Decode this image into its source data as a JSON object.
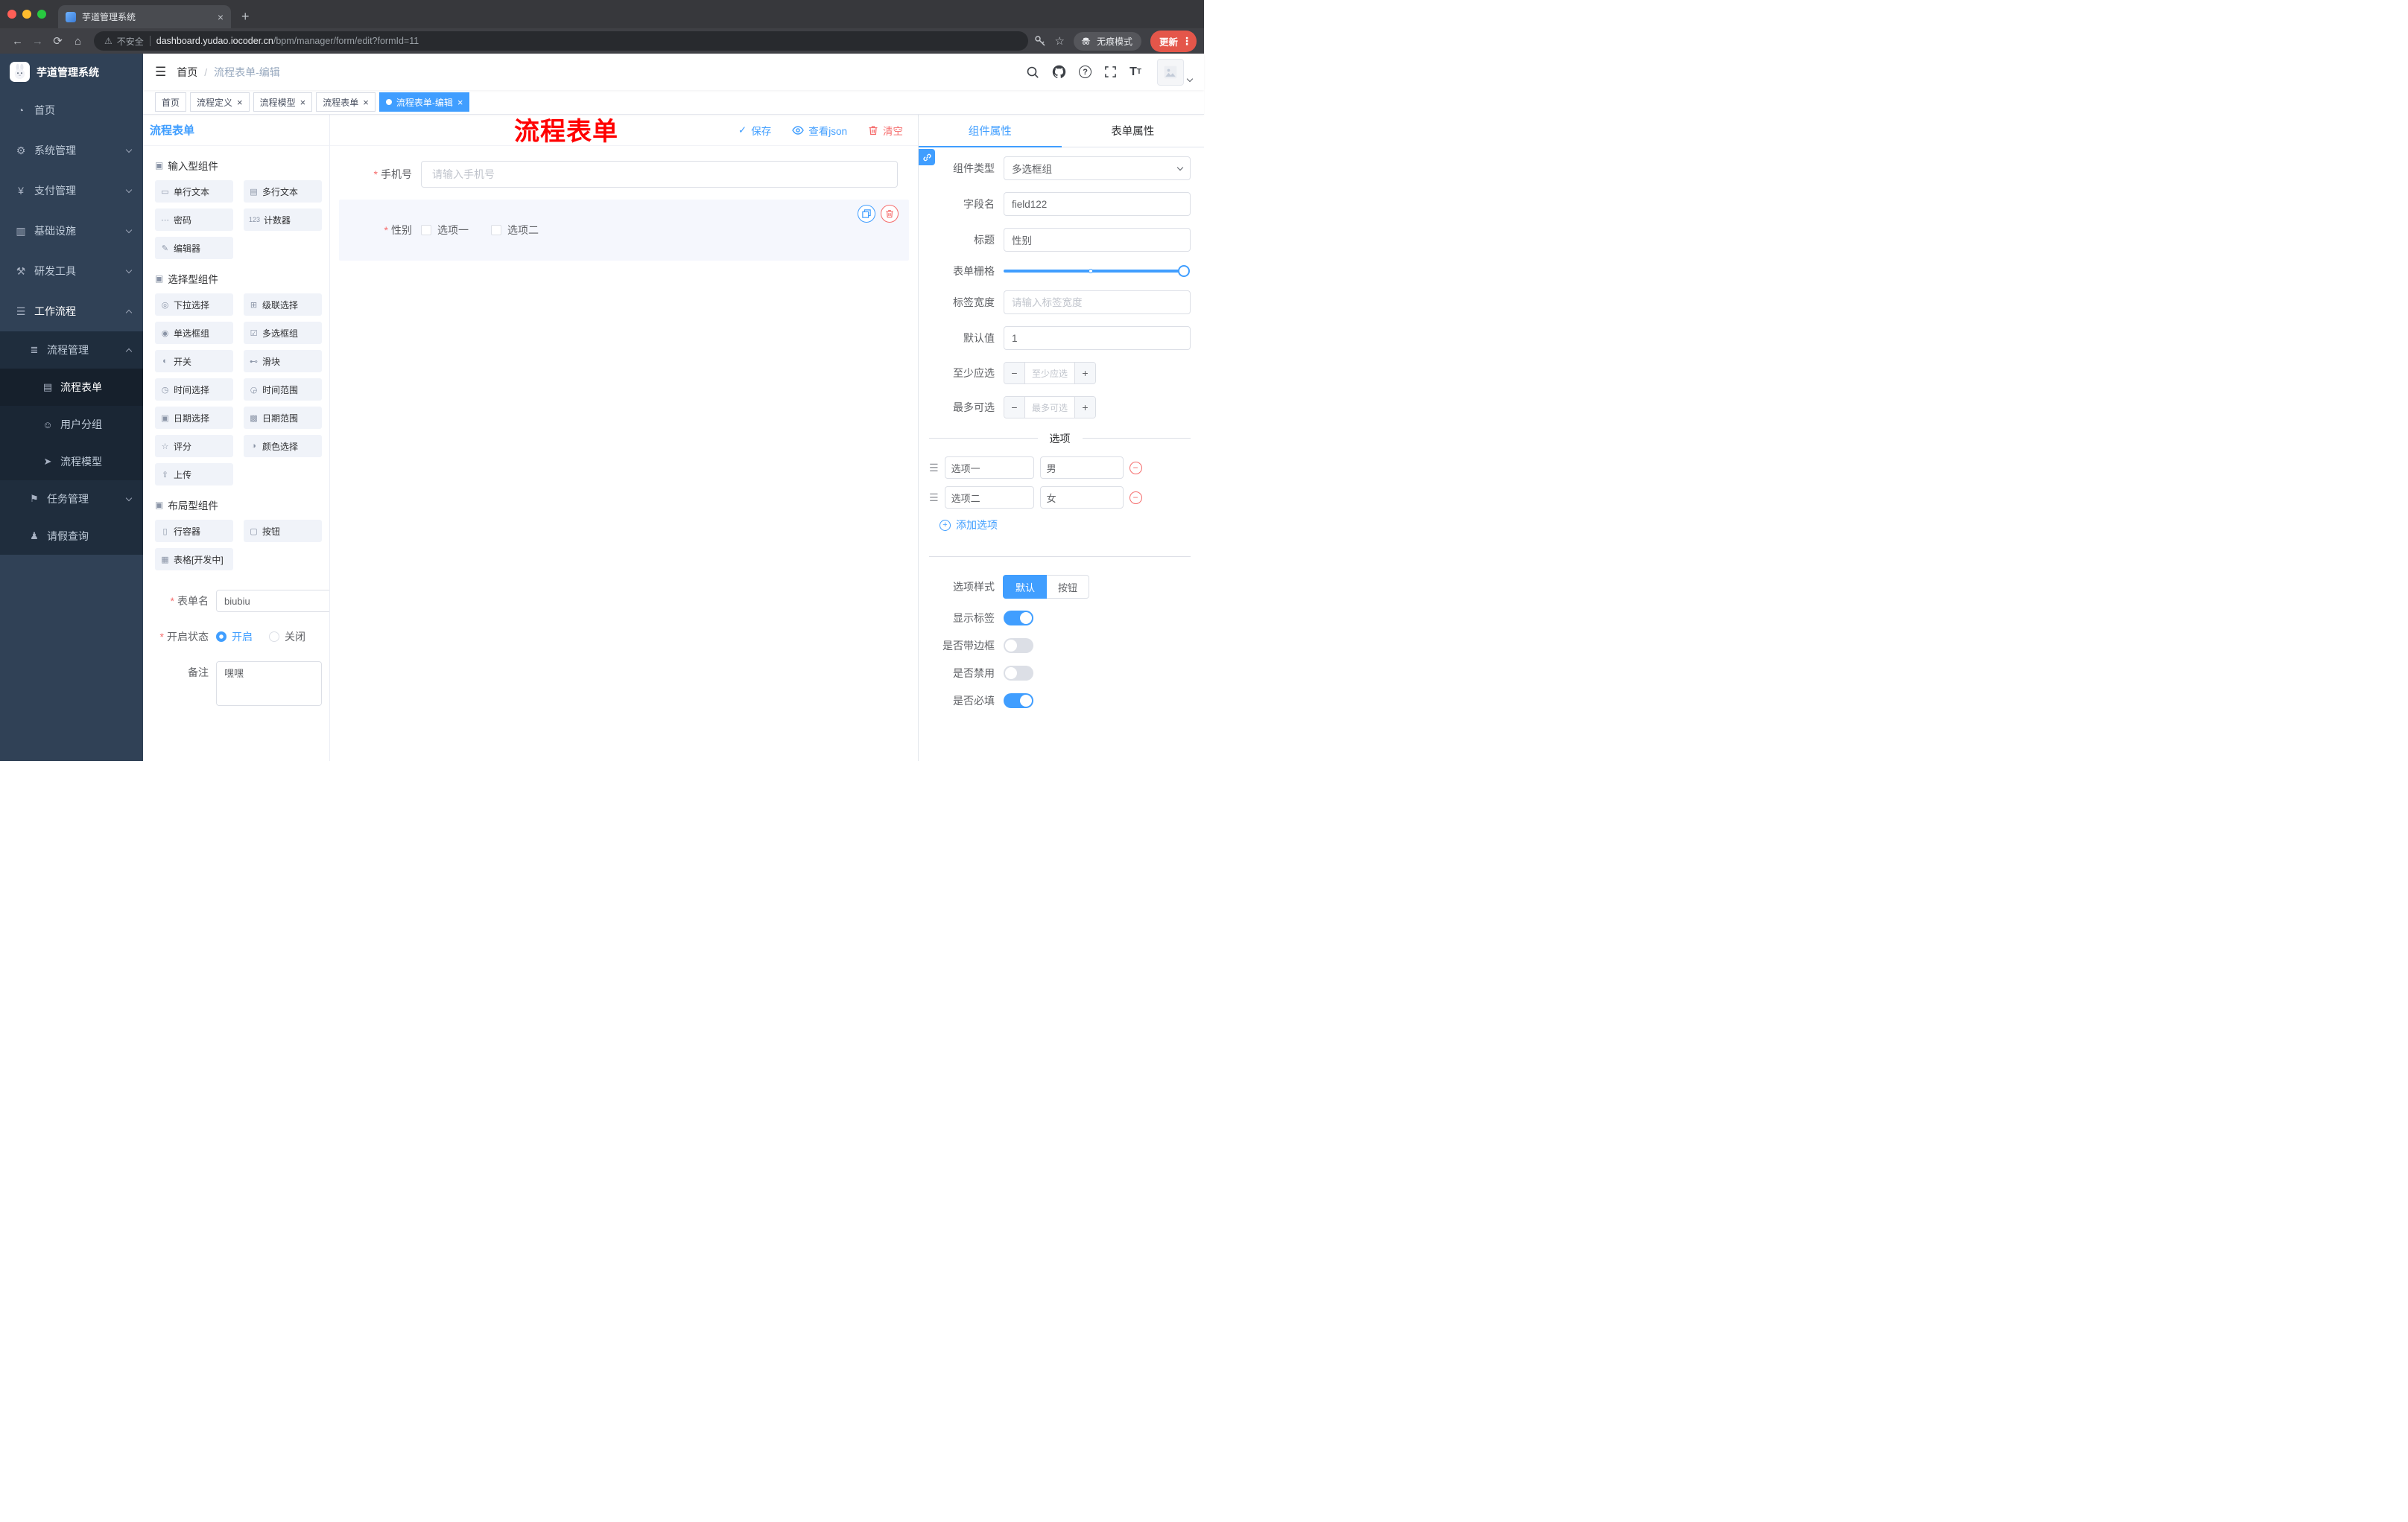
{
  "browser": {
    "tab_title": "芋道管理系统",
    "security": "不安全",
    "url_domain": "dashboard.yudao.iocoder.cn",
    "url_path": "/bpm/manager/form/edit?formId=11",
    "incognito": "无痕模式",
    "update": "更新"
  },
  "sidebar": {
    "title": "芋道管理系统",
    "menu": [
      {
        "label": "首页",
        "glyph": "◔"
      },
      {
        "label": "系统管理",
        "glyph": "⚙"
      },
      {
        "label": "支付管理",
        "glyph": "¥"
      },
      {
        "label": "基础设施",
        "glyph": "▥"
      },
      {
        "label": "研发工具",
        "glyph": "⚒"
      },
      {
        "label": "工作流程",
        "glyph": "☰"
      }
    ],
    "submenu": [
      {
        "label": "流程管理",
        "glyph": "≣"
      },
      {
        "label": "流程表单",
        "glyph": "▤"
      },
      {
        "label": "用户分组",
        "glyph": "☺"
      },
      {
        "label": "流程模型",
        "glyph": "➤"
      },
      {
        "label": "任务管理",
        "glyph": "⚑"
      },
      {
        "label": "请假查询",
        "glyph": "♟"
      }
    ]
  },
  "header": {
    "breadcrumb_home": "首页",
    "breadcrumb_sep": "/",
    "breadcrumb_current": "流程表单-编辑",
    "annotation": "流程表单"
  },
  "tags": [
    {
      "label": "首页"
    },
    {
      "label": "流程定义"
    },
    {
      "label": "流程模型"
    },
    {
      "label": "流程表单"
    },
    {
      "label": "流程表单-编辑"
    }
  ],
  "designer": {
    "title": "流程表单",
    "save": "保存",
    "view_json": "查看json",
    "clear": "清空"
  },
  "palette": {
    "sections": [
      {
        "title": "输入型组件",
        "items": [
          {
            "label": "单行文本",
            "glyph": "▭"
          },
          {
            "label": "多行文本",
            "glyph": "▤"
          },
          {
            "label": "密码",
            "glyph": "⋯"
          },
          {
            "label": "计数器",
            "glyph": "123"
          },
          {
            "label": "编辑器",
            "glyph": "✎"
          }
        ]
      },
      {
        "title": "选择型组件",
        "items": [
          {
            "label": "下拉选择",
            "glyph": "◎"
          },
          {
            "label": "级联选择",
            "glyph": "⊞"
          },
          {
            "label": "单选框组",
            "glyph": "◉"
          },
          {
            "label": "多选框组",
            "glyph": "☑"
          },
          {
            "label": "开关",
            "glyph": "◐"
          },
          {
            "label": "滑块",
            "glyph": "⊷"
          },
          {
            "label": "时间选择",
            "glyph": "◷"
          },
          {
            "label": "时间范围",
            "glyph": "◶"
          },
          {
            "label": "日期选择",
            "glyph": "▣"
          },
          {
            "label": "日期范围",
            "glyph": "▩"
          },
          {
            "label": "评分",
            "glyph": "☆"
          },
          {
            "label": "颜色选择",
            "glyph": "◑"
          },
          {
            "label": "上传",
            "glyph": "⇧"
          }
        ]
      },
      {
        "title": "布局型组件",
        "items": [
          {
            "label": "行容器",
            "glyph": "▯"
          },
          {
            "label": "按钮",
            "glyph": "▢"
          },
          {
            "label": "表格[开发中]",
            "glyph": "▦"
          }
        ]
      }
    ]
  },
  "meta": {
    "form_name_label": "表单名",
    "form_name_value": "biubiu",
    "status_label": "开启状态",
    "status_on": "开启",
    "status_off": "关闭",
    "remark_label": "备注",
    "remark_value": "嘿嘿"
  },
  "canvas": {
    "phone_label": "手机号",
    "phone_placeholder": "请输入手机号",
    "gender_label": "性别",
    "gender_options": [
      "选项一",
      "选项二"
    ]
  },
  "props": {
    "tab_component": "组件属性",
    "tab_form": "表单属性",
    "component_type_label": "组件类型",
    "component_type_value": "多选框组",
    "field_name_label": "字段名",
    "field_name_value": "field122",
    "title_label": "标题",
    "title_value": "性别",
    "grid_label": "表单栅格",
    "label_width_label": "标签宽度",
    "label_width_placeholder": "请输入标签宽度",
    "default_label": "默认值",
    "default_value": "1",
    "min_label": "至少应选",
    "min_placeholder": "至少应选",
    "max_label": "最多可选",
    "max_placeholder": "最多可选",
    "options_title": "选项",
    "options": [
      {
        "label": "选项一",
        "value": "男"
      },
      {
        "label": "选项二",
        "value": "女"
      }
    ],
    "add_option": "添加选项",
    "style_label": "选项样式",
    "style_default": "默认",
    "style_button": "按钮",
    "show_label": "显示标签",
    "border_label": "是否带边框",
    "disabled_label": "是否禁用",
    "required_label": "是否必填"
  },
  "colors": {
    "primary": "#409eff",
    "danger": "#f56c6c",
    "annotation": "#ff0000"
  }
}
